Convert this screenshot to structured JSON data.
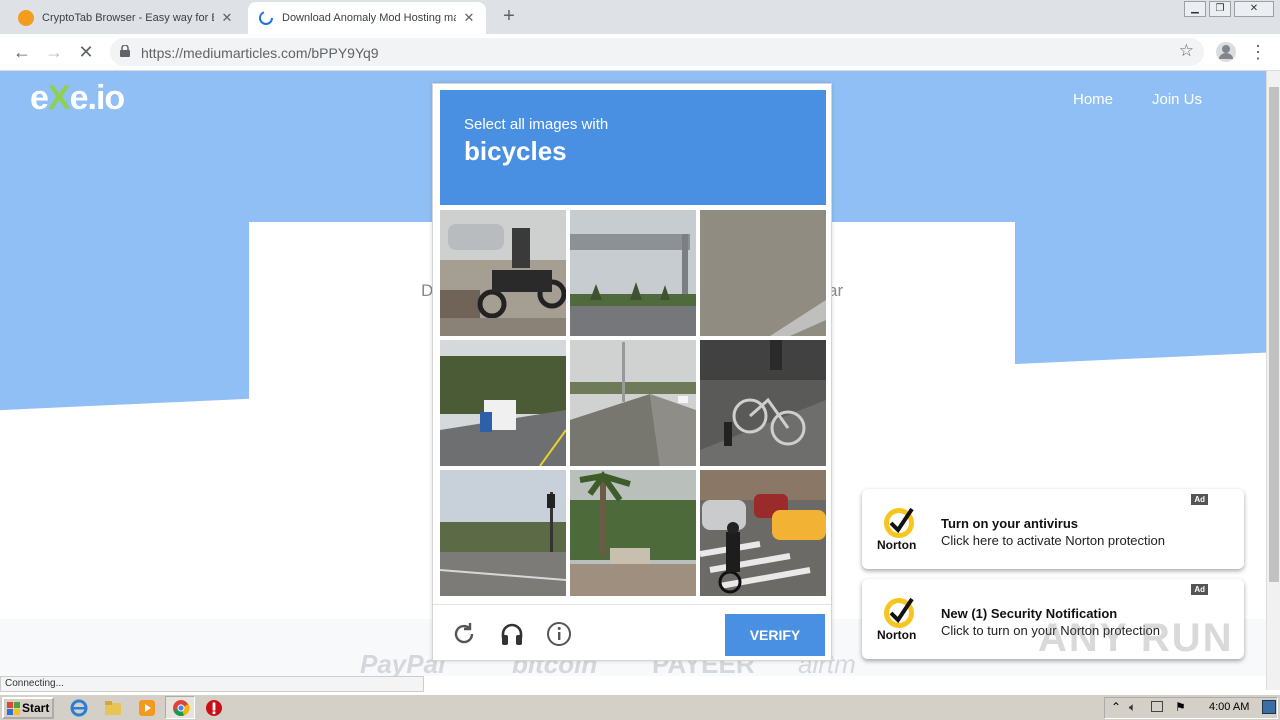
{
  "browser": {
    "tabs": [
      {
        "title": "CryptoTab Browser - Easy way for B",
        "active": false
      },
      {
        "title": "Download Anomaly Mod Hosting ma:",
        "active": true
      }
    ],
    "url": "https://mediumarticles.com/bPPY9Yq9",
    "status_text": "Connecting..."
  },
  "site": {
    "logo_left": "e",
    "logo_x": "X",
    "logo_right": "e.io",
    "nav": [
      "Home",
      "Join Us"
    ],
    "card_text_left": "D",
    "card_text_right": "ar",
    "payments": [
      "PayPal",
      "bitcoin",
      "PAYEER",
      "airtm"
    ]
  },
  "captcha": {
    "instruction": "Select all images with",
    "target": "bicycles",
    "verify_label": "VERIFY",
    "tiles": [
      "motorcycle-street",
      "highway-sign",
      "road-surface",
      "truck-highway",
      "overpass-road",
      "parked-bicycle",
      "intersection-traffic-light",
      "palm-entrance",
      "cyclist-crosswalk"
    ]
  },
  "notifications": [
    {
      "title": "Turn on your antivirus",
      "subtitle": "Click here to activate Norton protection",
      "ad": "Ad",
      "brand": "Norton"
    },
    {
      "title": "New (1) Security Notification",
      "subtitle": "Click to turn on your Norton protection",
      "ad": "Ad",
      "brand": "Norton"
    }
  ],
  "watermark": "ANY RUN",
  "taskbar": {
    "start_label": "Start",
    "clock": "4:00 AM"
  },
  "colors": {
    "hero": "#8fbff4",
    "captcha_blue": "#4a90e2",
    "logo_green": "#8fd14f"
  }
}
